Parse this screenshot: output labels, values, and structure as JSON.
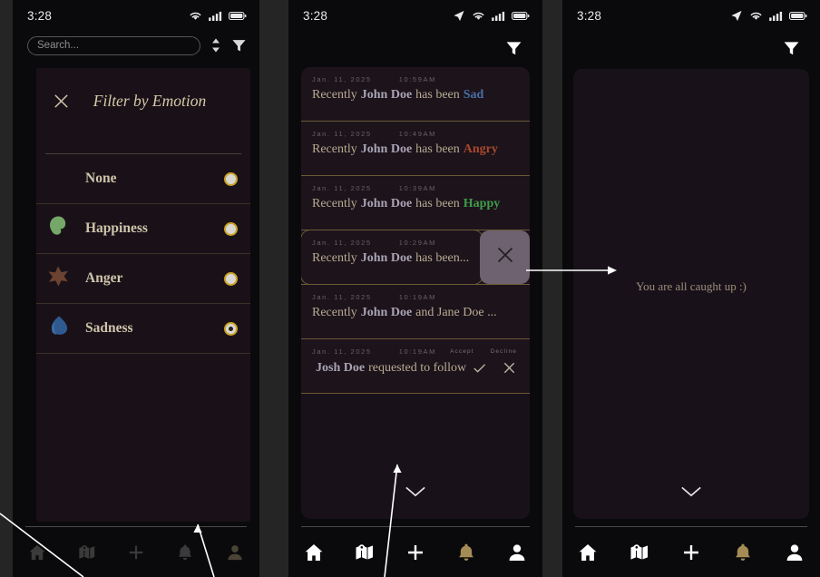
{
  "statusbar": {
    "time": "3:28"
  },
  "panel1": {
    "search": {
      "placeholder": "Search...",
      "value": ""
    },
    "sort_icon": "sort-updown-icon",
    "filter_icon": "filter-funnel-icon",
    "filter_panel": {
      "close_icon": "close-x-icon",
      "title": "Filter by Emotion",
      "options": [
        {
          "label": "None",
          "blob": "none",
          "selected": false
        },
        {
          "label": "Happiness",
          "blob": "happiness",
          "selected": false
        },
        {
          "label": "Anger",
          "blob": "anger",
          "selected": false
        },
        {
          "label": "Sadness",
          "blob": "sadness",
          "selected": true
        }
      ]
    }
  },
  "panel2": {
    "filter_icon": "filter-funnel-icon",
    "notifications": [
      {
        "date": "Jan. 11, 2025",
        "time": "10:59AM",
        "prefix": "Recently",
        "user": "John Doe",
        "mid": "has been",
        "emotion": "Sad",
        "emotion_class": "sad",
        "swiped": false,
        "request": false
      },
      {
        "date": "Jan. 11, 2025",
        "time": "10:49AM",
        "prefix": "Recently",
        "user": "John Doe",
        "mid": "has been",
        "emotion": "Angry",
        "emotion_class": "angry",
        "swiped": false,
        "request": false
      },
      {
        "date": "Jan. 11, 2025",
        "time": "10:39AM",
        "prefix": "Recently",
        "user": "John Doe",
        "mid": "has been",
        "emotion": "Happy",
        "emotion_class": "happy",
        "swiped": false,
        "request": false
      },
      {
        "date": "Jan. 11, 2025",
        "time": "10:29AM",
        "prefix": "Recently",
        "user": "John Doe",
        "mid": "has been...",
        "emotion": "",
        "emotion_class": "",
        "swiped": true,
        "request": false
      },
      {
        "date": "Jan. 11, 2025",
        "time": "10:19AM",
        "prefix": "Recently",
        "user": "John Doe",
        "mid": "and Jane Doe ...",
        "emotion": "",
        "emotion_class": "",
        "swiped": false,
        "request": false
      },
      {
        "date": "Jan. 11, 2025",
        "time": "10:19AM",
        "prefix": "",
        "user": "Josh Doe",
        "mid": "requested to follow",
        "emotion": "",
        "emotion_class": "",
        "swiped": false,
        "request": true,
        "accept_label": "Accept",
        "decline_label": "Decline"
      }
    ],
    "scroll_hint_icon": "chevron-down-icon",
    "delete_icon": "close-x-icon"
  },
  "panel3": {
    "filter_icon": "filter-funnel-icon",
    "empty_message": "You are all caught up :)",
    "scroll_hint_icon": "chevron-down-icon"
  },
  "bottom_nav": {
    "items": [
      {
        "name": "home",
        "icon": "home-icon",
        "active": false
      },
      {
        "name": "map",
        "icon": "map-pin-icon",
        "active": false
      },
      {
        "name": "add",
        "icon": "plus-icon",
        "active": false
      },
      {
        "name": "notifications",
        "icon": "bell-icon",
        "active": true
      },
      {
        "name": "profile",
        "icon": "person-icon",
        "active": false
      }
    ]
  },
  "colors": {
    "accent_gold": "#c9a227",
    "sad": "#4a6fa5",
    "angry": "#a8492c",
    "happy": "#3f9d4a",
    "card_bg": "#1a1118",
    "phone_bg": "#0a0a0c",
    "page_bg": "#252525"
  }
}
